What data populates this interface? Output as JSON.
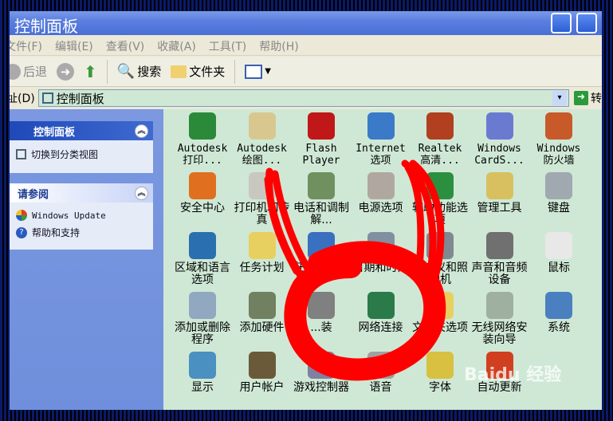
{
  "window": {
    "title": "控制面板"
  },
  "menu": [
    "文件(F)",
    "编辑(E)",
    "查看(V)",
    "收藏(A)",
    "工具(T)",
    "帮助(H)"
  ],
  "toolbar": {
    "back": "后退",
    "search": "搜索",
    "folders": "文件夹"
  },
  "address": {
    "label": "址(D)",
    "value": "控制面板",
    "go": "转"
  },
  "sidebar": {
    "panel1": {
      "title": "控制面板",
      "items": [
        "切换到分类视图"
      ]
    },
    "panel2": {
      "title": "请参阅",
      "items": [
        "Windows Update",
        "帮助和支持"
      ]
    }
  },
  "items": [
    {
      "label": "Autodesk 打印...",
      "icon": "printer-config-icon",
      "color": "#2a8a3a"
    },
    {
      "label": "Autodesk 绘图...",
      "icon": "plotter-icon",
      "color": "#d8c890"
    },
    {
      "label": "Flash Player",
      "icon": "flash-icon",
      "color": "#c01818"
    },
    {
      "label": "Internet 选项",
      "icon": "internet-options-icon",
      "color": "#3a7ac8"
    },
    {
      "label": "Realtek 高清...",
      "icon": "speaker-icon",
      "color": "#b04020"
    },
    {
      "label": "Windows CardS...",
      "icon": "cardspace-icon",
      "color": "#6a7ad0"
    },
    {
      "label": "Windows 防火墙",
      "icon": "firewall-icon",
      "color": "#c85a2a"
    },
    {
      "label": "安全中心",
      "icon": "shield-icon",
      "color": "#e07020"
    },
    {
      "label": "打印机和传真",
      "icon": "printer-icon",
      "color": "#c8c8c0"
    },
    {
      "label": "电话和调制解...",
      "icon": "phone-icon",
      "color": "#709060"
    },
    {
      "label": "电源选项",
      "icon": "power-icon",
      "color": "#b0a8a0"
    },
    {
      "label": "辅助功能选项",
      "icon": "accessibility-icon",
      "color": "#2a9040"
    },
    {
      "label": "管理工具",
      "icon": "admin-tools-icon",
      "color": "#d8c060"
    },
    {
      "label": "键盘",
      "icon": "keyboard-icon",
      "color": "#a0a8b0"
    },
    {
      "label": "区域和语言选项",
      "icon": "globe-icon",
      "color": "#2a70b0"
    },
    {
      "label": "任务计划",
      "icon": "scheduled-tasks-icon",
      "color": "#e8d060"
    },
    {
      "label": "任务栏和...",
      "icon": "taskbar-icon",
      "color": "#3a70c0"
    },
    {
      "label": "日期和时间",
      "icon": "clock-icon",
      "color": "#8090a0"
    },
    {
      "label": "扫描仪和照相机",
      "icon": "camera-icon",
      "color": "#808890"
    },
    {
      "label": "声音和音频设备",
      "icon": "sound-icon",
      "color": "#707070"
    },
    {
      "label": "鼠标",
      "icon": "mouse-icon",
      "color": "#e8e8e8"
    },
    {
      "label": "添加或删除程序",
      "icon": "add-remove-icon",
      "color": "#90a8c0"
    },
    {
      "label": "添加硬件",
      "icon": "hardware-icon",
      "color": "#708060"
    },
    {
      "label": "...装",
      "icon": "setup-icon",
      "color": "#808080"
    },
    {
      "label": "网络连接",
      "icon": "network-icon",
      "color": "#2a7a4a"
    },
    {
      "label": "文件夹选项",
      "icon": "folder-options-icon",
      "color": "#e8d060"
    },
    {
      "label": "无线网络安装向导",
      "icon": "wireless-icon",
      "color": "#a0b0a0"
    },
    {
      "label": "系统",
      "icon": "system-icon",
      "color": "#4a80c0"
    },
    {
      "label": "显示",
      "icon": "display-icon",
      "color": "#4a90c0"
    },
    {
      "label": "用户帐户",
      "icon": "users-icon",
      "color": "#6a5a3a"
    },
    {
      "label": "游戏控制器",
      "icon": "gamepad-icon",
      "color": "#8080a0"
    },
    {
      "label": "语音",
      "icon": "speech-icon",
      "color": "#a0a0a0"
    },
    {
      "label": "字体",
      "icon": "fonts-icon",
      "color": "#d8c040"
    },
    {
      "label": "自动更新",
      "icon": "auto-update-icon",
      "color": "#d04020"
    }
  ],
  "watermark": "Baidu 经验",
  "annotation_color": "#ff0000"
}
